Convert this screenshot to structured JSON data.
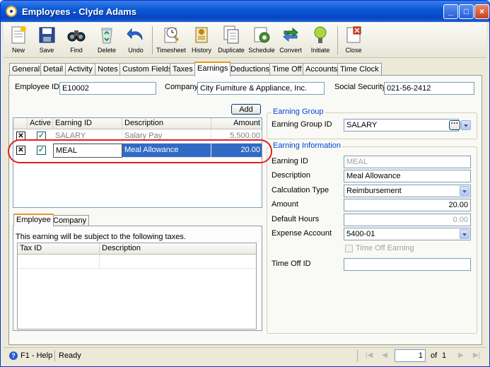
{
  "window": {
    "title": "Employees - Clyde  Adams"
  },
  "toolbar": {
    "new": "New",
    "save": "Save",
    "find": "Find",
    "delete": "Delete",
    "undo": "Undo",
    "timesheet": "Timesheet",
    "history": "History",
    "duplicate": "Duplicate",
    "schedule": "Schedule",
    "convert": "Convert",
    "initiate": "Initiate",
    "close": "Close"
  },
  "tabs": [
    "General",
    "Detail",
    "Activity",
    "Notes",
    "Custom Fields",
    "Taxes",
    "Earnings",
    "Deductions",
    "Time Off",
    "Accounts",
    "Time Clock"
  ],
  "active_tab": "Earnings",
  "header": {
    "employee_id_label": "Employee ID",
    "employee_id": "E10002",
    "company_label": "Company",
    "company": "City Furniture & Appliance, Inc.",
    "ssn_label": "Social Security",
    "ssn": "021-56-2412"
  },
  "earnings": {
    "add_label": "Add",
    "columns": {
      "active": "Active",
      "earning_id": "Earning ID",
      "description": "Description",
      "amount": "Amount"
    },
    "rows": [
      {
        "earning_id": "SALARY",
        "description": "Salary Pay",
        "amount": "5,500.00",
        "active": true
      },
      {
        "earning_id": "MEAL",
        "description": "Meal Allowance",
        "amount": "20.00",
        "active": true
      }
    ]
  },
  "subtabs": [
    "Employee",
    "Company"
  ],
  "tax_panel": {
    "message": "This earning will be subject to the following taxes.",
    "columns": {
      "tax_id": "Tax ID",
      "description": "Description"
    }
  },
  "earning_group": {
    "title": "Earning Group",
    "id_label": "Earning Group ID",
    "id_value": "SALARY"
  },
  "earning_info": {
    "title": "Earning Information",
    "earning_id_label": "Earning ID",
    "earning_id": "MEAL",
    "description_label": "Description",
    "description": "Meal Allowance",
    "calc_type_label": "Calculation Type",
    "calc_type": "Reimbursement",
    "amount_label": "Amount",
    "amount": "20.00",
    "default_hours_label": "Default Hours",
    "default_hours": "0.00",
    "expense_account_label": "Expense Account",
    "expense_account": "5400-01",
    "time_off_earning_label": "Time Off Earning",
    "time_off_id_label": "Time Off ID",
    "time_off_id": ""
  },
  "status": {
    "help": "F1 - Help",
    "text": "Ready",
    "page": "1",
    "of_label": "of",
    "total": "1"
  },
  "colors": {
    "selected_row": "#316ac5",
    "highlight_oval": "#e02020",
    "titlebar": "#0a5ad6"
  }
}
